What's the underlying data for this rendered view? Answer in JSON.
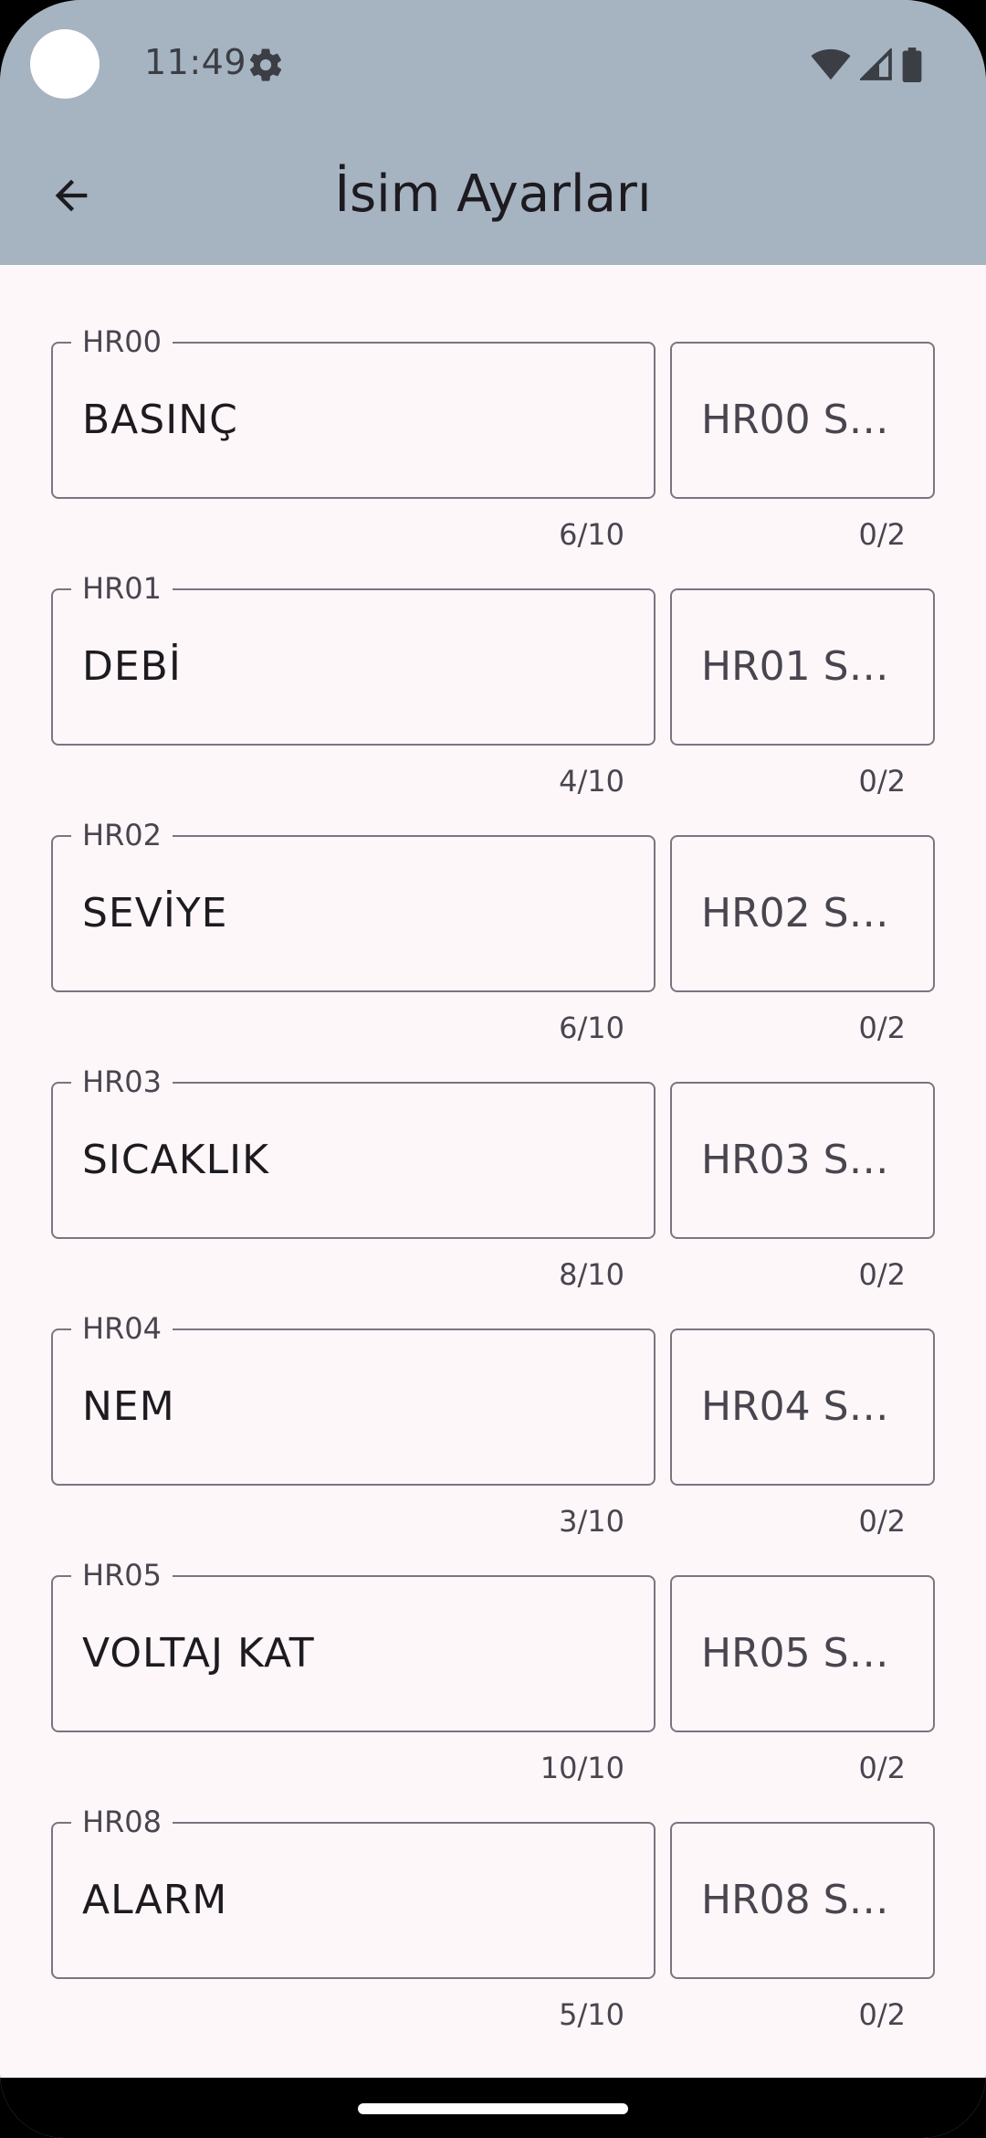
{
  "status_bar": {
    "time": "11:49",
    "icons": [
      "settings-icon",
      "wifi-icon",
      "signal-icon",
      "battery-icon"
    ]
  },
  "app_bar": {
    "title": "İsim Ayarları",
    "back_icon": "arrow-back-icon"
  },
  "colors": {
    "top_bar": "#a6b3c1",
    "background": "#fdf7fa",
    "outline": "#7a757f",
    "text": "#1d1b20",
    "secondary_text": "#49454f"
  },
  "rows": [
    {
      "label": "HR00",
      "value": "BASINÇ",
      "symbol_placeholder": "HR00 Se…",
      "name_counter": "6/10",
      "symbol_counter": "0/2"
    },
    {
      "label": "HR01",
      "value": "DEBİ",
      "symbol_placeholder": "HR01 Se…",
      "name_counter": "4/10",
      "symbol_counter": "0/2"
    },
    {
      "label": "HR02",
      "value": "SEVİYE",
      "symbol_placeholder": "HR02 Se…",
      "name_counter": "6/10",
      "symbol_counter": "0/2"
    },
    {
      "label": "HR03",
      "value": "SICAKLIK",
      "symbol_placeholder": "HR03 Se…",
      "name_counter": "8/10",
      "symbol_counter": "0/2"
    },
    {
      "label": "HR04",
      "value": "NEM",
      "symbol_placeholder": "HR04 Se…",
      "name_counter": "3/10",
      "symbol_counter": "0/2"
    },
    {
      "label": "HR05",
      "value": "VOLTAJ KAT",
      "symbol_placeholder": "HR05 Se…",
      "name_counter": "10/10",
      "symbol_counter": "0/2"
    },
    {
      "label": "HR08",
      "value": "ALARM",
      "symbol_placeholder": "HR08 Se…",
      "name_counter": "5/10",
      "symbol_counter": "0/2"
    }
  ]
}
